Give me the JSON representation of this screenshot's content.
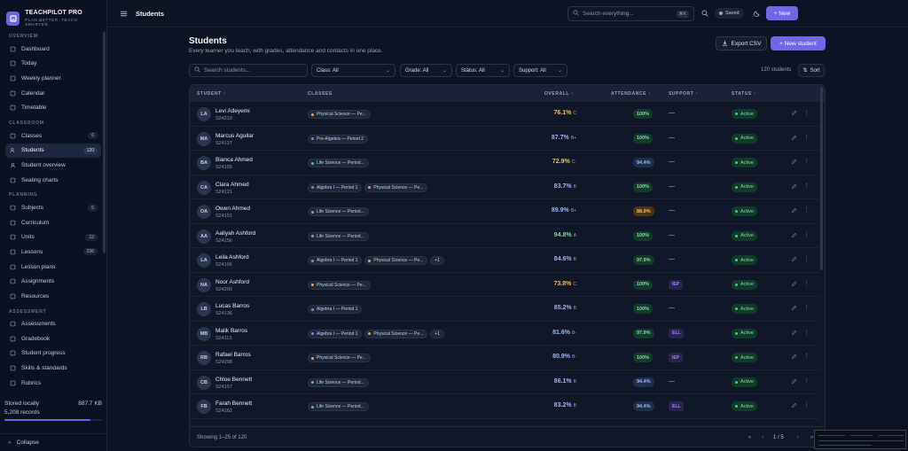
{
  "brand": {
    "name": "TEACHPILOT PRO",
    "tagline": "PLAN BETTER. TEACH SMARTER."
  },
  "sidebar": {
    "sections": [
      {
        "title": "OVERVIEW",
        "items": [
          {
            "label": "Dashboard",
            "icon": "grid-icon"
          },
          {
            "label": "Today",
            "icon": "calendar-day-icon"
          },
          {
            "label": "Weekly planner",
            "icon": "calendar-week-icon"
          },
          {
            "label": "Calendar",
            "icon": "calendar-icon"
          },
          {
            "label": "Timetable",
            "icon": "table-icon"
          }
        ]
      },
      {
        "title": "CLASSROOM",
        "items": [
          {
            "label": "Classes",
            "icon": "book-icon",
            "count": "6"
          },
          {
            "label": "Students",
            "icon": "users-icon",
            "count": "120",
            "active": true
          },
          {
            "label": "Student overview",
            "icon": "user-icon"
          },
          {
            "label": "Seating charts",
            "icon": "layout-icon"
          }
        ]
      },
      {
        "title": "PLANNING",
        "items": [
          {
            "label": "Subjects",
            "icon": "layers-icon",
            "count": "5"
          },
          {
            "label": "Curriculum",
            "icon": "map-icon"
          },
          {
            "label": "Units",
            "icon": "folder-icon",
            "count": "12"
          },
          {
            "label": "Lessons",
            "icon": "file-icon",
            "count": "236"
          },
          {
            "label": "Lesson plans",
            "icon": "clipboard-icon"
          },
          {
            "label": "Assignments",
            "icon": "check-file-icon"
          },
          {
            "label": "Resources",
            "icon": "archive-icon"
          }
        ]
      },
      {
        "title": "ASSESSMENT",
        "items": [
          {
            "label": "Assessments",
            "icon": "checklist-icon"
          },
          {
            "label": "Gradebook",
            "icon": "book-open-icon"
          },
          {
            "label": "Student progress",
            "icon": "trend-icon"
          },
          {
            "label": "Skills & standards",
            "icon": "target-icon"
          },
          {
            "label": "Rubrics",
            "icon": "rubric-icon"
          }
        ]
      }
    ],
    "storage": {
      "label": "Stored locally",
      "size": "887.7 KB",
      "records": "5,208 records",
      "fill": 0.88
    },
    "collapse_label": "Collapse"
  },
  "topbar": {
    "crumb": "Students",
    "search_placeholder": "Search everything...",
    "search_kbd": "⌘K",
    "saved": "Saved",
    "new_label": "+ New"
  },
  "page": {
    "title": "Students",
    "subtitle": "Every learner you teach, with grades, attendance and contacts in one place.",
    "export_label": "Export CSV",
    "new_student_label": "+ New student"
  },
  "filters": {
    "search_placeholder": "Search students...",
    "class": "Class: All",
    "grade": "Grade: All",
    "status": "Status: All",
    "support": "Support: All",
    "count": "120 students",
    "sort": "Sort"
  },
  "table": {
    "headers": {
      "student": "STUDENT ↑",
      "classes": "CLASSES",
      "overall": "OVERALL ↑",
      "attendance": "ATTENDANCE ↑",
      "support": "SUPPORT ↑",
      "status": "STATUS ↑"
    },
    "rows": [
      {
        "initials": "LA",
        "name": "Levi Adeyemi",
        "id": "S24210",
        "classes": [
          {
            "label": "Physical Science — Pe...",
            "color": "#e0a458"
          }
        ],
        "more": "",
        "overall": "76.1%",
        "overall_color": "#f2c24f",
        "grade": "C",
        "attendance": "100%",
        "att_level": "good",
        "support": "—",
        "status": "Active"
      },
      {
        "initials": "MA",
        "name": "Marcus Aguilar",
        "id": "S24127",
        "classes": [
          {
            "label": "Pre-Algebra — Period 2",
            "color": "#6f8cf0"
          }
        ],
        "more": "",
        "overall": "87.7%",
        "overall_color": "#9db8f5",
        "grade": "B+",
        "attendance": "100%",
        "att_level": "good",
        "support": "—",
        "status": "Active"
      },
      {
        "initials": "BA",
        "name": "Bianca Ahmed",
        "id": "S24155",
        "classes": [
          {
            "label": "Life Science — Period...",
            "color": "#4fc48e"
          }
        ],
        "more": "",
        "overall": "72.9%",
        "overall_color": "#f2c24f",
        "grade": "C-",
        "attendance": "94.4%",
        "att_level": "mid",
        "support": "—",
        "status": "Active"
      },
      {
        "initials": "CA",
        "name": "Clara Ahmed",
        "id": "S24121",
        "classes": [
          {
            "label": "Algebra I — Period 1",
            "color": "#6f8cf0"
          },
          {
            "label": "Physical Science — Pe...",
            "color": "#e0a458"
          }
        ],
        "more": "",
        "overall": "83.7%",
        "overall_color": "#9db8f5",
        "grade": "B",
        "attendance": "100%",
        "att_level": "good",
        "support": "—",
        "status": "Active"
      },
      {
        "initials": "OA",
        "name": "Owen Ahmed",
        "id": "S24151",
        "classes": [
          {
            "label": "Life Science — Period...",
            "color": "#4fc48e"
          }
        ],
        "more": "",
        "overall": "89.9%",
        "overall_color": "#9db8f5",
        "grade": "B+",
        "attendance": "88.9%",
        "att_level": "warn",
        "support": "—",
        "status": "Active"
      },
      {
        "initials": "AA",
        "name": "Aaliyah Ashford",
        "id": "S24156",
        "classes": [
          {
            "label": "Life Science — Period...",
            "color": "#4fc48e"
          }
        ],
        "more": "",
        "overall": "94.8%",
        "overall_color": "#6fdca8",
        "grade": "A",
        "attendance": "100%",
        "att_level": "good",
        "support": "—",
        "status": "Active"
      },
      {
        "initials": "LA",
        "name": "Leila Ashford",
        "id": "S24106",
        "classes": [
          {
            "label": "Algebra I — Period 1",
            "color": "#6f8cf0"
          },
          {
            "label": "Physical Science — Pe...",
            "color": "#e0a458"
          }
        ],
        "more": "+1",
        "overall": "84.6%",
        "overall_color": "#9db8f5",
        "grade": "B",
        "attendance": "97.9%",
        "att_level": "good",
        "support": "—",
        "status": "Active"
      },
      {
        "initials": "NA",
        "name": "Noor Ashford",
        "id": "S24200",
        "classes": [
          {
            "label": "Physical Science — Pe...",
            "color": "#e0a458"
          }
        ],
        "more": "",
        "overall": "73.8%",
        "overall_color": "#f2c24f",
        "grade": "C",
        "attendance": "100%",
        "att_level": "good",
        "support": "IEP",
        "status": "Active"
      },
      {
        "initials": "LB",
        "name": "Lucas Barros",
        "id": "S24136",
        "classes": [
          {
            "label": "Algebra I — Period 1",
            "color": "#6f8cf0"
          }
        ],
        "more": "",
        "overall": "85.2%",
        "overall_color": "#9db8f5",
        "grade": "B",
        "attendance": "100%",
        "att_level": "good",
        "support": "—",
        "status": "Active"
      },
      {
        "initials": "MB",
        "name": "Malik Barros",
        "id": "S24113",
        "classes": [
          {
            "label": "Algebra I — Period 1",
            "color": "#6f8cf0"
          },
          {
            "label": "Physical Science — Pe...",
            "color": "#e0a458"
          }
        ],
        "more": "+1",
        "overall": "81.6%",
        "overall_color": "#9db8f5",
        "grade": "B-",
        "attendance": "97.9%",
        "att_level": "good",
        "support": "ELL",
        "status": "Active"
      },
      {
        "initials": "RB",
        "name": "Rafael Barros",
        "id": "S24208",
        "classes": [
          {
            "label": "Physical Science — Pe...",
            "color": "#e0a458"
          }
        ],
        "more": "",
        "overall": "80.9%",
        "overall_color": "#9db8f5",
        "grade": "B-",
        "attendance": "100%",
        "att_level": "good",
        "support": "IEP",
        "status": "Active"
      },
      {
        "initials": "CB",
        "name": "Chloe Bennett",
        "id": "S24157",
        "classes": [
          {
            "label": "Life Science — Period...",
            "color": "#4fc48e"
          }
        ],
        "more": "",
        "overall": "86.1%",
        "overall_color": "#9db8f5",
        "grade": "B",
        "attendance": "94.4%",
        "att_level": "mid",
        "support": "—",
        "status": "Active"
      },
      {
        "initials": "FB",
        "name": "Farah Bennett",
        "id": "S24162",
        "classes": [
          {
            "label": "Life Science — Period...",
            "color": "#4fc48e"
          }
        ],
        "more": "",
        "overall": "83.2%",
        "overall_color": "#9db8f5",
        "grade": "B",
        "attendance": "94.4%",
        "att_level": "mid",
        "support": "ELL",
        "status": "Active"
      }
    ],
    "footer": {
      "showing": "Showing 1–25 of 120",
      "page": "1 / 5"
    }
  },
  "colors": {
    "accent": "#6f67ea",
    "active_green": "#3fd08c",
    "warn": "#e0a458"
  }
}
